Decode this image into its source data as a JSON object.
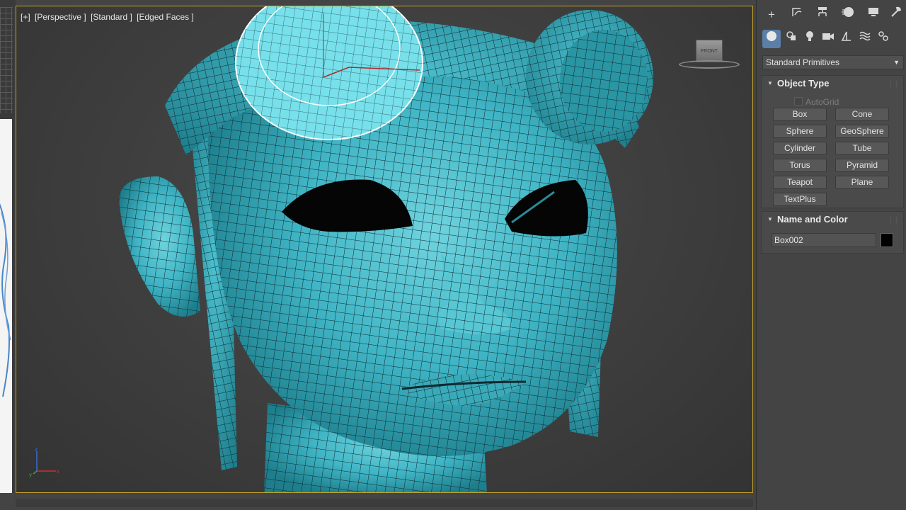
{
  "viewport": {
    "labels": [
      "[+]",
      "[Perspective ]",
      "[Standard ]",
      "[Edged Faces ]"
    ],
    "viewcube_label": "FRONT",
    "axis": {
      "z": "z",
      "y": "y",
      "x": "x"
    },
    "mesh_color": "#3fb4c4",
    "border_color": "#c9a52a"
  },
  "command_panel": {
    "tabs": [
      "create-icon",
      "modify-icon",
      "hierarchy-icon",
      "motion-icon",
      "display-icon",
      "utilities-icon"
    ],
    "subtabs": [
      "geometry-icon",
      "shapes-icon",
      "lights-icon",
      "cameras-icon",
      "helpers-icon",
      "spacewarps-icon",
      "systems-icon"
    ],
    "dropdown_value": "Standard Primitives",
    "object_type": {
      "title": "Object Type",
      "autogrid_label": "AutoGrid",
      "buttons": [
        "Box",
        "Cone",
        "Sphere",
        "GeoSphere",
        "Cylinder",
        "Tube",
        "Torus",
        "Pyramid",
        "Teapot",
        "Plane",
        "TextPlus"
      ]
    },
    "name_and_color": {
      "title": "Name and Color",
      "name_value": "Box002",
      "swatch_color": "#000000"
    }
  }
}
